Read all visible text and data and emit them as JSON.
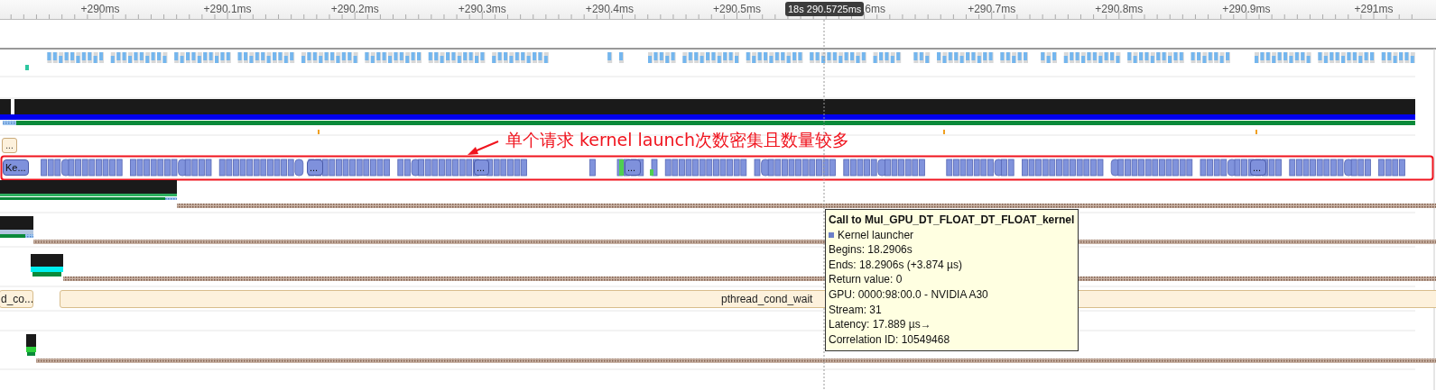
{
  "timeline": {
    "ticks": [
      {
        "label": "+290ms",
        "cut": false
      },
      {
        "label": "+290.1ms",
        "cut": false
      },
      {
        "label": "+290.2ms",
        "cut": false
      },
      {
        "label": "+290.3ms",
        "cut": false
      },
      {
        "label": "+290.4ms",
        "cut": false
      },
      {
        "label": "+290.5ms",
        "cut": false
      },
      {
        "label": "6ms",
        "cut": true
      },
      {
        "label": "+290.7ms",
        "cut": false
      },
      {
        "label": "+290.8ms",
        "cut": false
      },
      {
        "label": "+290.9ms",
        "cut": false
      },
      {
        "label": "+291ms",
        "cut": false
      }
    ],
    "cursor_label": "18s 290.5725ms"
  },
  "collapsed_row": {
    "label": "..."
  },
  "annotation": {
    "text": "单个请求 kernel launch次数密集且数量较多"
  },
  "kernel_launches": {
    "labels": [
      "Ke...",
      "...",
      "...",
      "...",
      "..."
    ]
  },
  "os_runtime": [
    {
      "label": "d_co..."
    },
    {
      "label": "pthread_cond_wait"
    }
  ],
  "tooltip": {
    "title": "Call to Mul_GPU_DT_FLOAT_DT_FLOAT_kernel",
    "legend": "Kernel launcher",
    "lines": [
      "Begins: 18.2906s",
      "Ends: 18.2906s (+3.874 µs)",
      "Return value: 0",
      "GPU: 0000:98:00.0 - NVIDIA A30",
      "Stream: 31",
      "Latency: 17.889 µs→",
      "Correlation ID: 10549468"
    ]
  }
}
